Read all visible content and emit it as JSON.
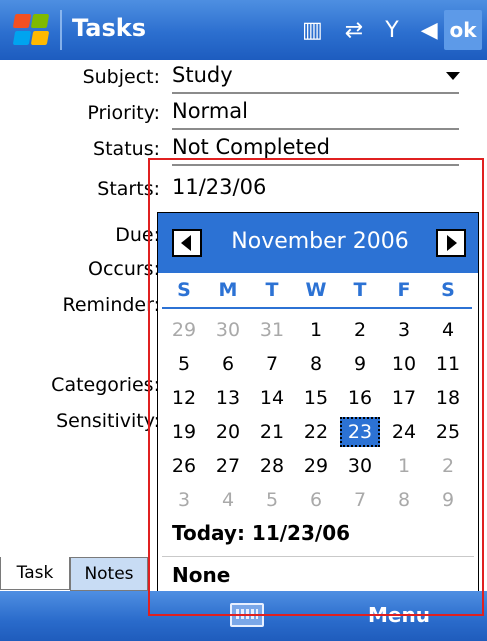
{
  "titlebar": {
    "title": "Tasks",
    "ok": "ok"
  },
  "form": {
    "subject": {
      "label": "Subject:",
      "value": "Study"
    },
    "priority": {
      "label": "Priority:",
      "value": "Normal"
    },
    "status": {
      "label": "Status:",
      "value": "Not Completed"
    },
    "starts": {
      "label": "Starts:",
      "value": "11/23/06"
    },
    "due": {
      "label": "Due:"
    },
    "occurs": {
      "label": "Occurs:"
    },
    "reminder": {
      "label": "Reminder:"
    },
    "categories": {
      "label": "Categories:"
    },
    "sensitivity": {
      "label": "Sensitivity:"
    }
  },
  "calendar": {
    "month_title": "November 2006",
    "weekdays": [
      "S",
      "M",
      "T",
      "W",
      "T",
      "F",
      "S"
    ],
    "weeks": [
      [
        "29",
        "30",
        "31",
        "1",
        "2",
        "3",
        "4"
      ],
      [
        "5",
        "6",
        "7",
        "8",
        "9",
        "10",
        "11"
      ],
      [
        "12",
        "13",
        "14",
        "15",
        "16",
        "17",
        "18"
      ],
      [
        "19",
        "20",
        "21",
        "22",
        "23",
        "24",
        "25"
      ],
      [
        "26",
        "27",
        "28",
        "29",
        "30",
        "1",
        "2"
      ],
      [
        "3",
        "4",
        "5",
        "6",
        "7",
        "8",
        "9"
      ]
    ],
    "selected": "23",
    "today": "Today: 11/23/06",
    "none": "None"
  },
  "tabs": {
    "task": "Task",
    "notes": "Notes"
  },
  "bottombar": {
    "menu": "Menu"
  },
  "colors": {
    "accent": "#2c72d4",
    "highlight": "#e02020"
  }
}
